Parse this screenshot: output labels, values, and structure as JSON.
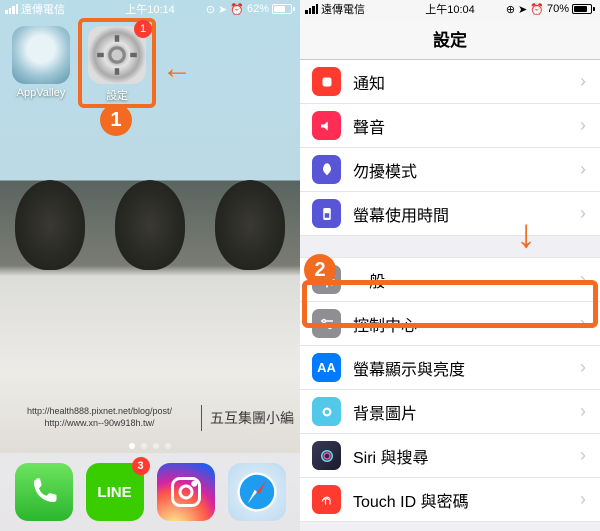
{
  "annotations": {
    "step1": "1",
    "step2": "2",
    "arrow_left": "←",
    "arrow_down": "↓"
  },
  "left": {
    "status": {
      "carrier": "遠傳電信",
      "time": "上午10:14",
      "battery_pct": "62%",
      "battery_fill": 62
    },
    "apps": {
      "appvalley": {
        "label": "AppValley"
      },
      "settings": {
        "label": "設定",
        "badge": "1"
      }
    },
    "watermark": {
      "url1": "http://health888.pixnet.net/blog/post/",
      "url2": "http://www.xn--90w918h.tw/",
      "name": "五互集團小編"
    },
    "dock": {
      "phone": "Phone",
      "line": "LINE",
      "line_badge": "3",
      "instagram": "Instagram",
      "safari": "Safari"
    }
  },
  "right": {
    "status": {
      "carrier": "遠傳電信",
      "time": "上午10:04",
      "battery_pct": "70%",
      "battery_fill": 70
    },
    "title": "設定",
    "rows": {
      "notifications": "通知",
      "sounds": "聲音",
      "dnd": "勿擾模式",
      "screentime": "螢幕使用時間",
      "general": "一般",
      "control": "控制中心",
      "display": "螢幕顯示與亮度",
      "wallpaper": "背景圖片",
      "siri": "Siri 與搜尋",
      "touchid": "Touch ID 與密碼"
    }
  }
}
